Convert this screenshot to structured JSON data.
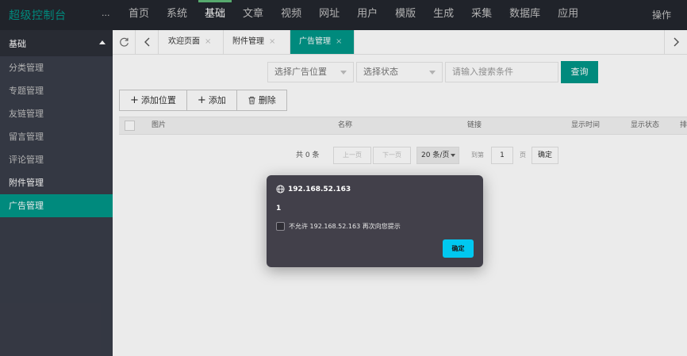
{
  "header": {
    "brand": "超级控制台",
    "more": "···",
    "nav": [
      "首页",
      "系统",
      "基础",
      "文章",
      "视频",
      "网址",
      "用户",
      "模版",
      "生成",
      "采集",
      "数据库",
      "应用"
    ],
    "active_nav": "基础",
    "operate": "操作"
  },
  "sidebar": {
    "group": "基础",
    "items": [
      "分类管理",
      "专题管理",
      "友链管理",
      "留言管理",
      "评论管理",
      "附件管理",
      "广告管理"
    ],
    "active": "广告管理"
  },
  "tabs": {
    "refresh_icon": "refresh-icon",
    "back_icon": "chevron-left-icon",
    "forward_icon": "chevron-right-icon",
    "items": [
      {
        "label": "欢迎页面",
        "close": "×"
      },
      {
        "label": "附件管理",
        "close": "×"
      },
      {
        "label": "广告管理",
        "close": "×"
      }
    ],
    "active": "广告管理"
  },
  "search": {
    "position_select": "选择广告位置",
    "status_select": "选择状态",
    "keyword_placeholder": "请输入搜索条件",
    "query_label": "查询"
  },
  "toolbar": {
    "add_position": "添加位置",
    "add": "添加",
    "delete": "删除",
    "plus_icon": "+"
  },
  "table": {
    "columns": [
      "图片",
      "名称",
      "链接",
      "显示时间",
      "显示状态",
      "排"
    ]
  },
  "pagination": {
    "total": "共 0 条",
    "prev": "上一页",
    "next": "下一页",
    "page_size": "20 条/页",
    "goto_label": "到第",
    "page_value": "1",
    "page_unit": "页",
    "confirm": "确定"
  },
  "dialog": {
    "origin": "192.168.52.163",
    "message": "1",
    "suppress_label": "不允许 192.168.52.163 再次向您提示",
    "ok_label": "确定"
  },
  "colors": {
    "accent": "#009688",
    "topbar": "#23262e",
    "sidebar": "#393d49",
    "dialog_bg": "#42404a",
    "dialog_button": "#00c8f0"
  }
}
